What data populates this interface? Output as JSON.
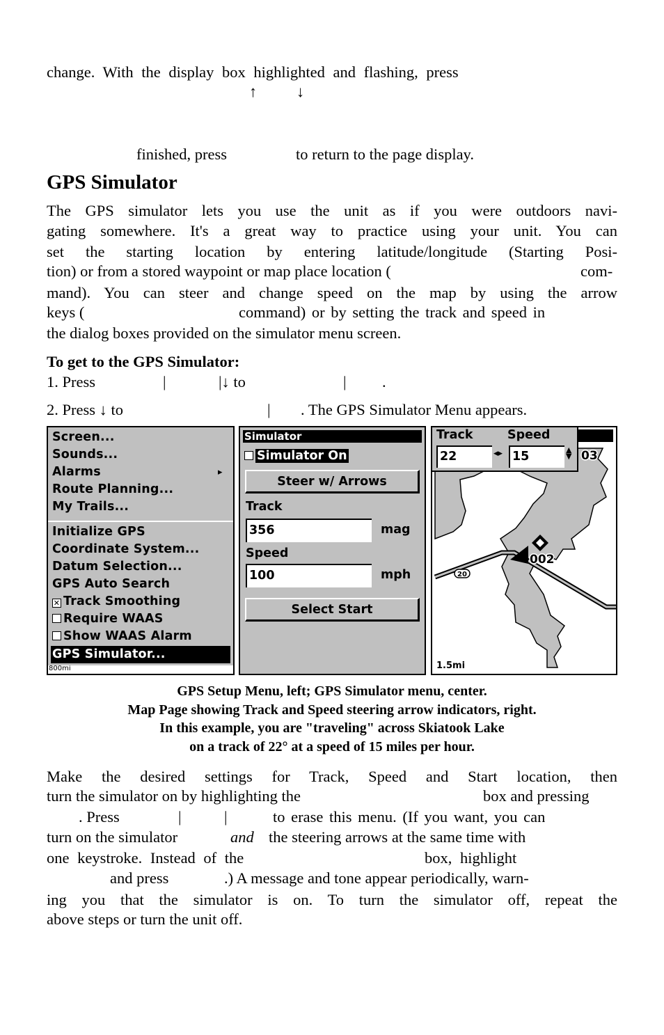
{
  "top_text": {
    "line1": "change. With the display box highlighted and flashing, press",
    "arrow_up": "↑",
    "arrow_down": "↓",
    "line3": "finished, press",
    "line3b": "to return to the page display."
  },
  "section": {
    "title": "GPS Simulator",
    "intro_lines": [
      "The GPS simulator lets you use the unit as if you were outdoors navi-",
      "gating somewhere. It's a great way to practice using your unit. You can",
      "set the starting location by entering latitude/longitude (Starting Posi-",
      "tion) or from a stored waypoint or map place location (",
      "com-",
      "mand). You can steer and change speed on the map by using the arrow",
      "keys (",
      "command) or by setting the track and speed in",
      "the dialog boxes provided on the simulator menu screen."
    ],
    "steps_title": "To get to the GPS Simulator:",
    "step1": {
      "a": "1. Press",
      "sep1": "|",
      "sep2": "|↓ to",
      "sep3": "|",
      "end": "."
    },
    "step2": {
      "a": "2. Press ↓ to",
      "sep": "|",
      "end": ". The GPS Simulator Menu appears."
    }
  },
  "setup_menu": {
    "items": [
      "Screen...",
      "Sounds...",
      "Alarms",
      "Route Planning...",
      "My Trails..."
    ],
    "submenu_arrow": "▸",
    "gps_items": [
      {
        "label": "Initialize GPS",
        "checkbox": null
      },
      {
        "label": "Coordinate System...",
        "checkbox": null
      },
      {
        "label": "Datum Selection...",
        "checkbox": null
      },
      {
        "label": "GPS Auto Search",
        "checkbox": null
      },
      {
        "label": "Track Smoothing",
        "checkbox": "checked"
      },
      {
        "label": "Require WAAS",
        "checkbox": "unchecked"
      },
      {
        "label": "Show WAAS Alarm",
        "checkbox": "unchecked"
      },
      {
        "label": "GPS Simulator...",
        "checkbox": null,
        "selected": true
      }
    ],
    "scale": "800mi"
  },
  "simulator_menu": {
    "title": "Simulator",
    "simulator_on_label": "Simulator On",
    "simulator_on_checked": false,
    "steer_button": "Steer w/ Arrows",
    "track_label": "Track",
    "track_value": "356",
    "track_unit": "mag",
    "speed_label": "Speed",
    "speed_value": "100",
    "speed_unit": "mph",
    "select_start_button": "Select Start"
  },
  "map_page": {
    "track_label": "Track",
    "track_value": "22",
    "speed_label": "Speed",
    "speed_value": "15",
    "waypoint_label": "002",
    "waypoint_partial": "03",
    "road_label": "20",
    "scale": "1.5mi"
  },
  "caption": [
    "GPS Setup Menu, left; GPS Simulator menu, center.",
    "Map Page showing Track and Speed steering arrow indicators, right.",
    "In this example, you are \"traveling\" across Skiatook Lake",
    "on a track of 22° at a speed of 15 miles per hour."
  ],
  "body_lines": [
    "Make the desired settings for Track, Speed and Start location, then",
    "turn the simulator on by highlighting the",
    "box and pressing",
    ". Press",
    "|",
    "|",
    "to erase this menu. (If you want, you can",
    "turn on the simulator",
    "and",
    "the steering arrows at the same time with",
    "one keystroke. Instead of the",
    "box, highlight",
    "and press",
    ".) A message and tone appear periodically, warn-",
    "ing you that the simulator is on. To turn the simulator off, repeat the",
    "above steps or turn the unit off."
  ]
}
